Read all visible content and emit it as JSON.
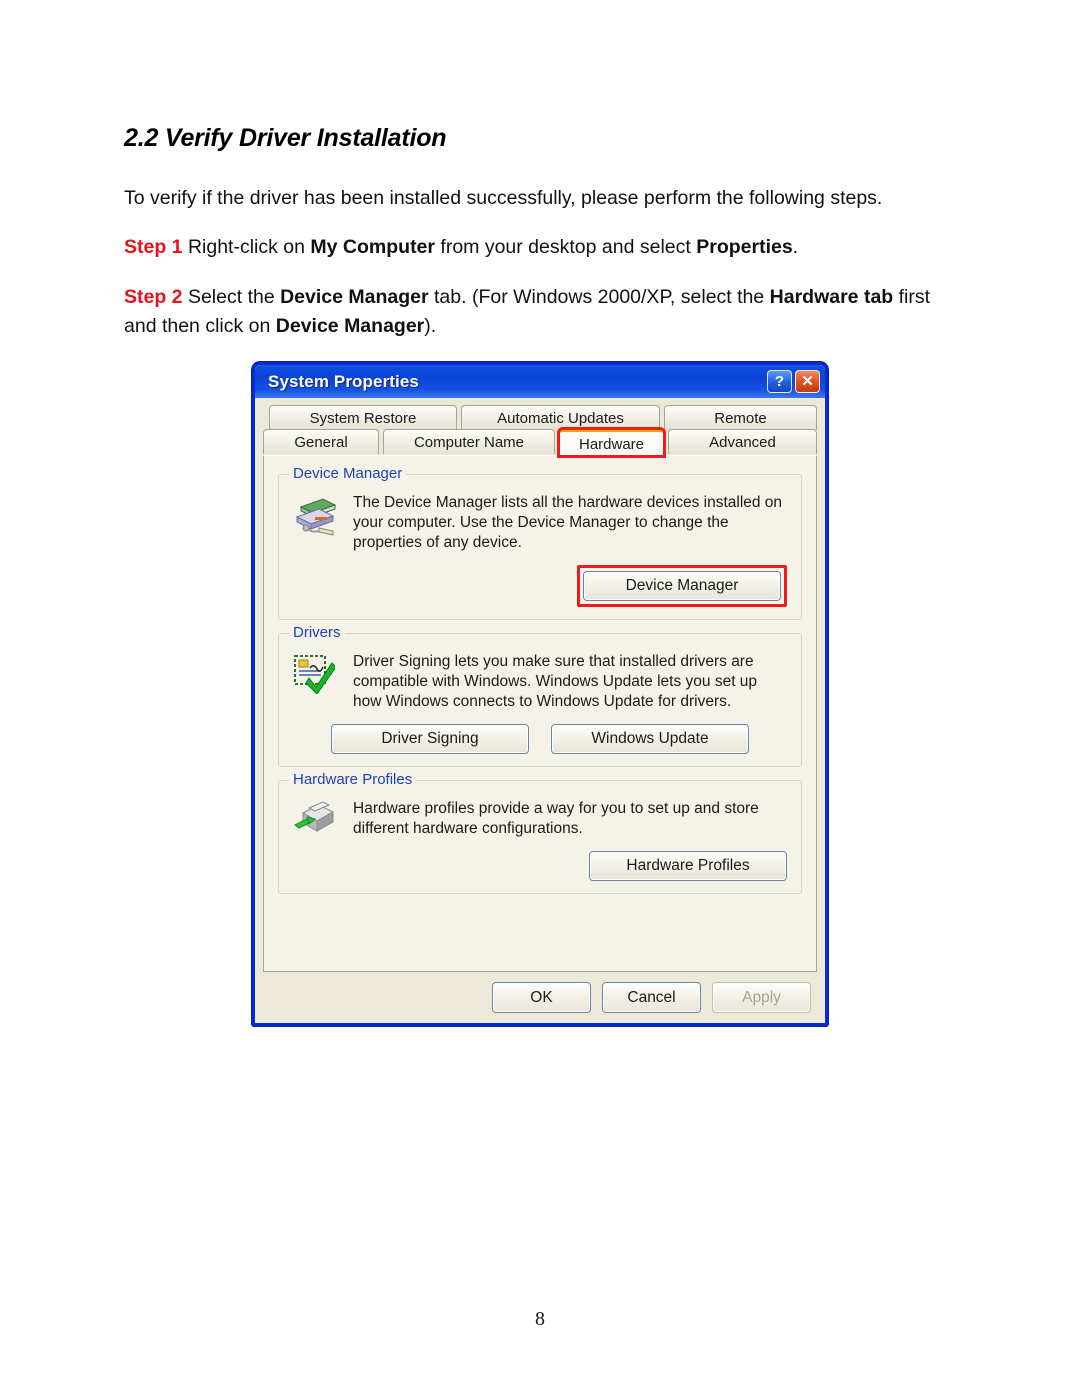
{
  "document": {
    "heading": "2.2 Verify Driver Installation",
    "intro": "To verify if the driver has been installed successfully, please perform the following steps.",
    "step1": {
      "label": "Step 1",
      "text_a": " Right-click on ",
      "bold_a": "My Computer",
      "text_b": " from your desktop and select ",
      "bold_b": "Properties",
      "text_c": "."
    },
    "step2": {
      "label": "Step 2",
      "text_a": " Select the ",
      "bold_a": "Device Manager",
      "text_b": " tab. (For Windows 2000/XP, select the ",
      "bold_b": "Hardware tab",
      "text_c": " first and then click on ",
      "bold_c": "Device Manager",
      "text_d": ")."
    },
    "page_number": "8"
  },
  "dialog": {
    "title": "System Properties",
    "titlebar_buttons": {
      "help": "?",
      "close": "✕"
    },
    "tabs_row1": [
      {
        "label": "System Restore",
        "active": false
      },
      {
        "label": "Automatic Updates",
        "active": false
      },
      {
        "label": "Remote",
        "active": false
      }
    ],
    "tabs_row2": [
      {
        "label": "General",
        "active": false
      },
      {
        "label": "Computer Name",
        "active": false
      },
      {
        "label": "Hardware",
        "active": true
      },
      {
        "label": "Advanced",
        "active": false
      }
    ],
    "groups": {
      "device_manager": {
        "legend": "Device Manager",
        "description": "The Device Manager lists all the hardware devices installed on your computer. Use the Device Manager to change the properties of any device.",
        "button": "Device Manager"
      },
      "drivers": {
        "legend": "Drivers",
        "description": "Driver Signing lets you make sure that installed drivers are compatible with Windows. Windows Update lets you set up how Windows connects to Windows Update for drivers.",
        "button_driver_signing": "Driver Signing",
        "button_windows_update": "Windows Update"
      },
      "hardware_profiles": {
        "legend": "Hardware Profiles",
        "description": "Hardware profiles provide a way for you to set up and store different hardware configurations.",
        "button": "Hardware Profiles"
      }
    },
    "footer": {
      "ok": "OK",
      "cancel": "Cancel",
      "apply": "Apply",
      "apply_disabled": true
    }
  },
  "colors": {
    "step_label_red": "#e8121a",
    "highlight_red": "#ee1b1b",
    "titlebar_blue": "#0b43d6",
    "group_legend_blue": "#1d42b5",
    "dialog_face": "#ece9d8",
    "active_tab_orange": "#f0a30a"
  }
}
